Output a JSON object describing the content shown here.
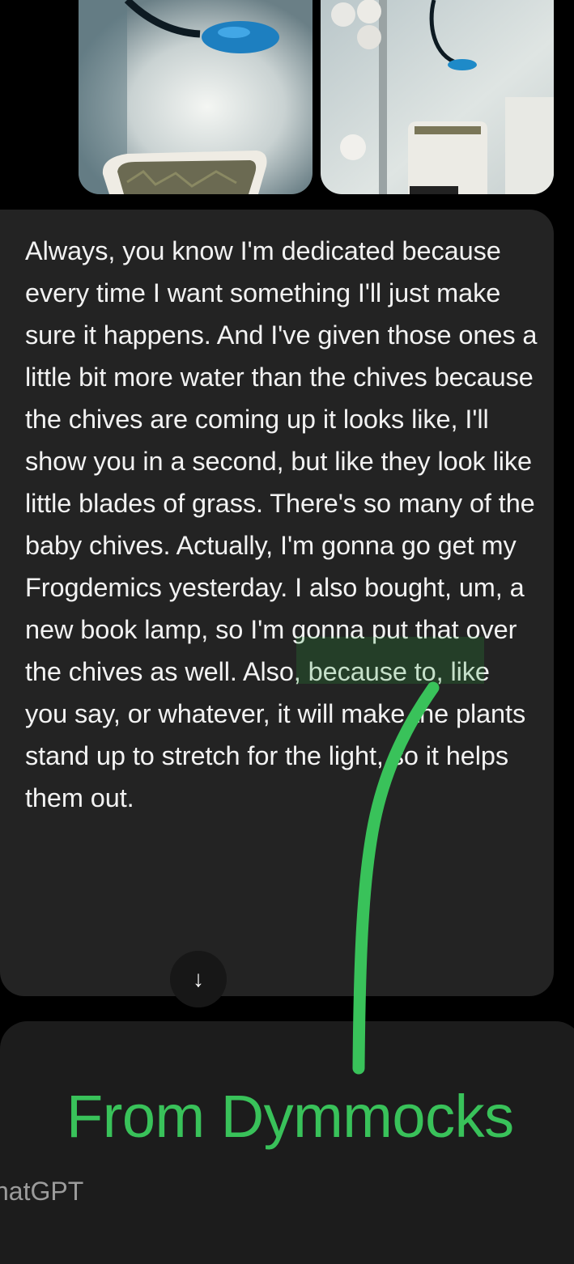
{
  "message": {
    "text": "Always, you know I'm dedicated because every time I want something I'll just make sure it happens. And I've given those ones a little bit more water than the chives because the chives are coming up it looks like, I'll show you in a second, but like they look like little blades of grass. There's so many of the baby chives. Actually, I'm gonna go get my Frogdemics yesterday. I also bought, um, a new book lamp, so I'm gonna put that over the chives as well. Also, because to, like you say, or whatever, it will make the plants stand up to stretch for the light, so it helps them out."
  },
  "scroll_button": {
    "icon": "arrow-down-icon",
    "glyph": "↓"
  },
  "composer": {
    "placeholder": "hatGPT"
  },
  "annotation": {
    "label": "From Dymmocks",
    "color": "#39c25a"
  },
  "attachments": [
    {
      "name": "plant-photo-left"
    },
    {
      "name": "plant-photo-right"
    }
  ]
}
